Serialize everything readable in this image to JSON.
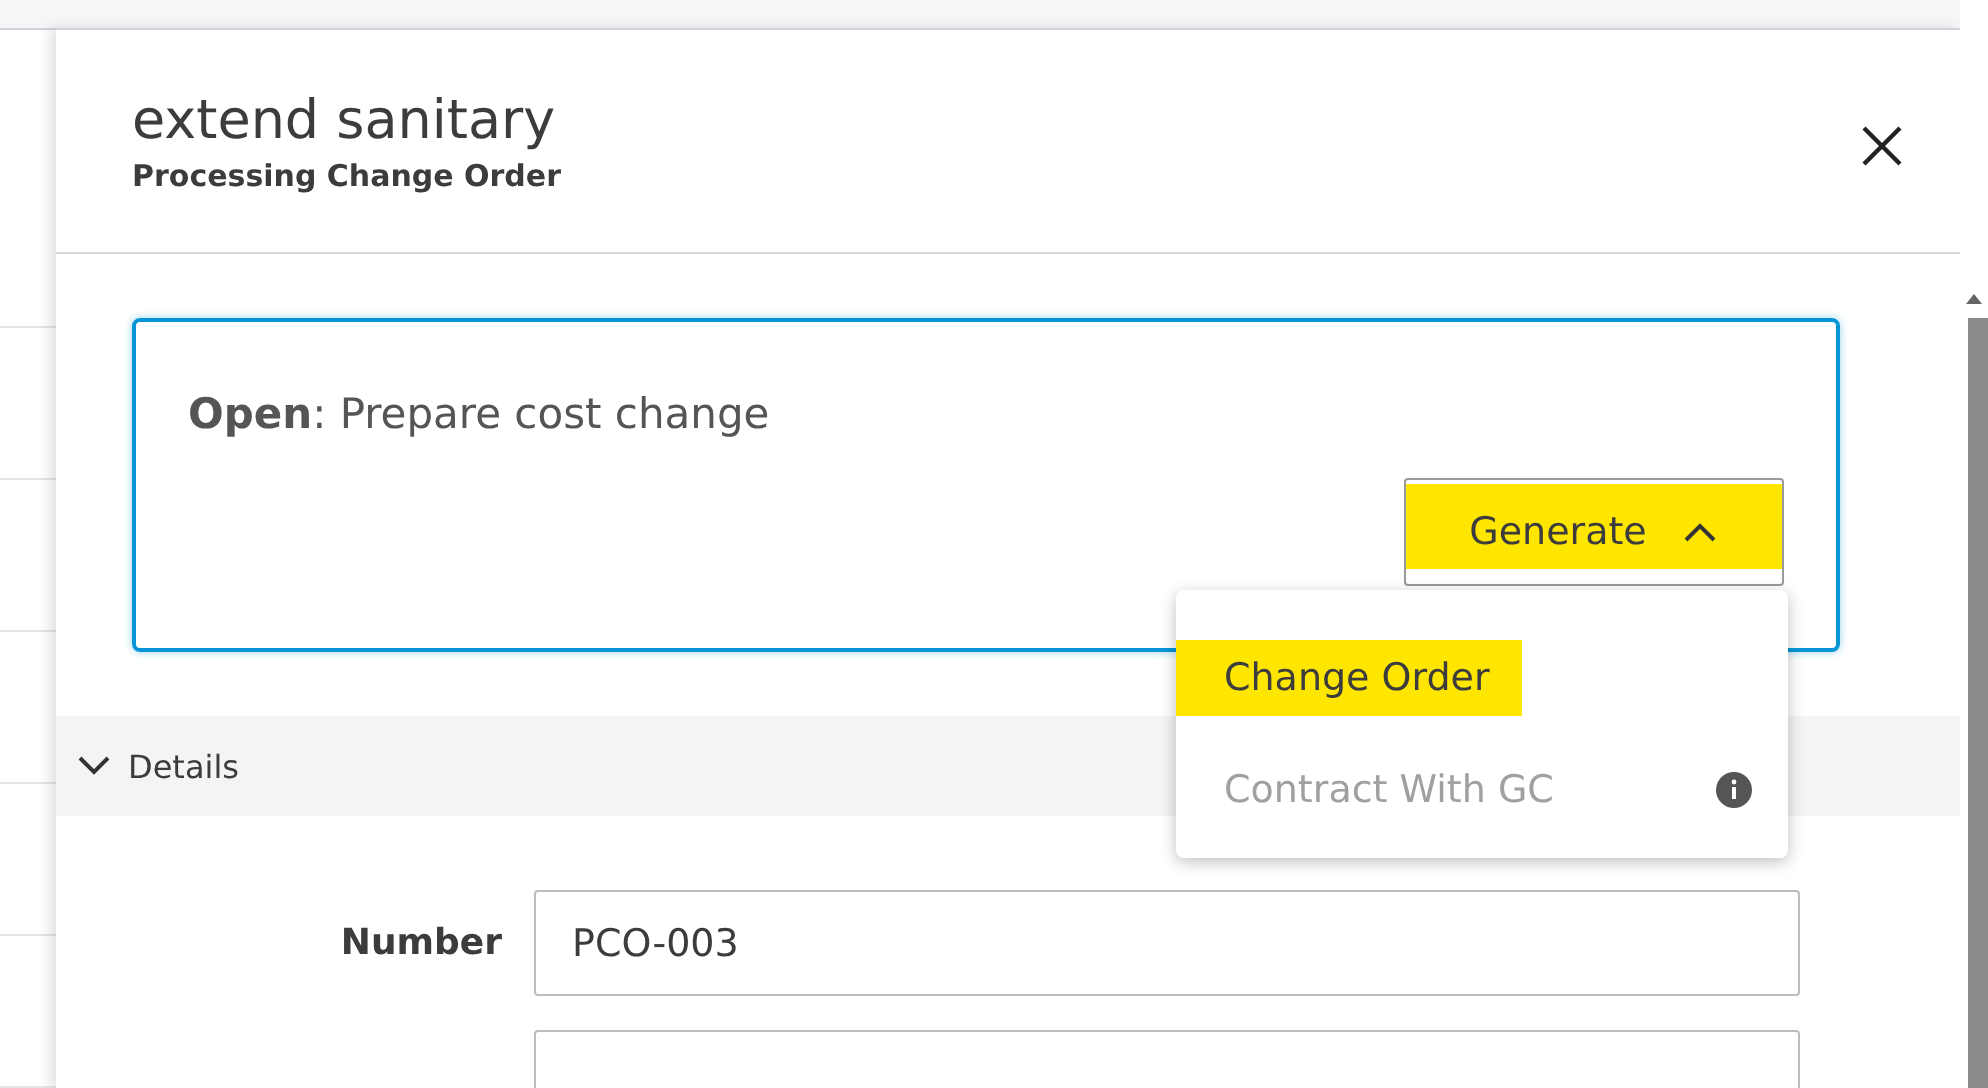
{
  "panel": {
    "title": "extend sanitary",
    "subtitle": "Processing Change Order"
  },
  "status_card": {
    "text": "**Open**: Prepare cost change",
    "generate_button": {
      "label": "Generate",
      "expanded": true,
      "highlighted": true
    }
  },
  "generate_menu": [
    {
      "label": "Change Order",
      "disabled": false,
      "highlighted": true,
      "info": false
    },
    {
      "label": "Contract With GC",
      "disabled": true,
      "highlighted": false,
      "info": true
    }
  ],
  "section": {
    "label": "Details",
    "expanded": true
  },
  "fields": [
    {
      "label": "Number",
      "value": "PCO-003"
    }
  ]
}
